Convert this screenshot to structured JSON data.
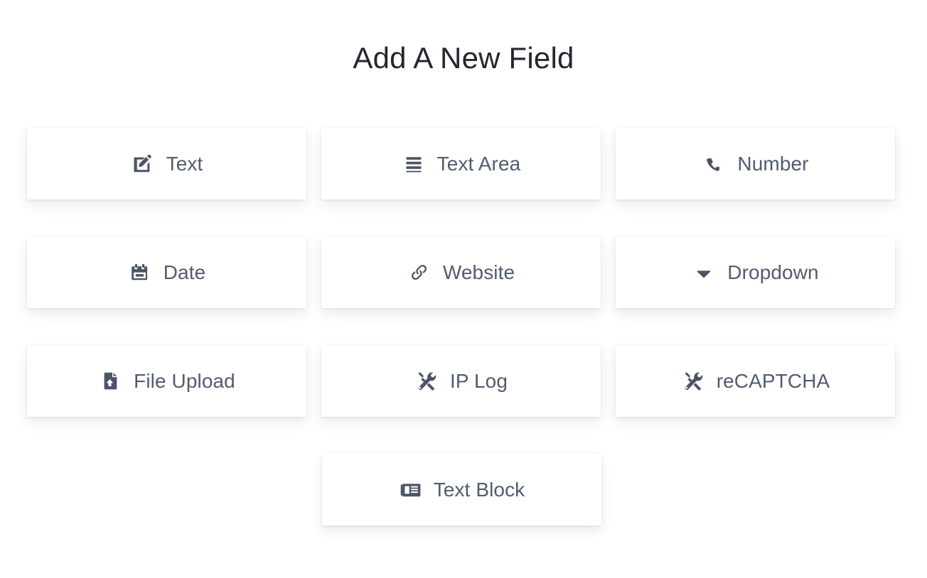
{
  "header": {
    "title": "Add A New Field"
  },
  "colors": {
    "page_background": "#ffffff",
    "card_background": "#ffffff",
    "title_text": "#23272e",
    "label_text": "#515c6e",
    "icon": "#4b5466"
  },
  "field_rows": [
    {
      "cards": [
        {
          "label": "Text",
          "icon": "edit-square-pencil-icon"
        },
        {
          "label": "Text Area",
          "icon": "bars-lines-icon"
        },
        {
          "label": "Number",
          "icon": "phone-handset-icon"
        }
      ]
    },
    {
      "cards": [
        {
          "label": "Date",
          "icon": "calendar-icon"
        },
        {
          "label": "Website",
          "icon": "chain-link-icon"
        },
        {
          "label": "Dropdown",
          "icon": "caret-down-icon"
        }
      ]
    },
    {
      "cards": [
        {
          "label": "File Upload",
          "icon": "file-upload-icon"
        },
        {
          "label": "IP Log",
          "icon": "tools-screwdriver-wrench-icon"
        },
        {
          "label": "reCAPTCHA",
          "icon": "tools-screwdriver-wrench-icon"
        }
      ]
    },
    {
      "centered": true,
      "cards": [
        {
          "label": "Text Block",
          "icon": "newspaper-icon"
        }
      ]
    }
  ]
}
